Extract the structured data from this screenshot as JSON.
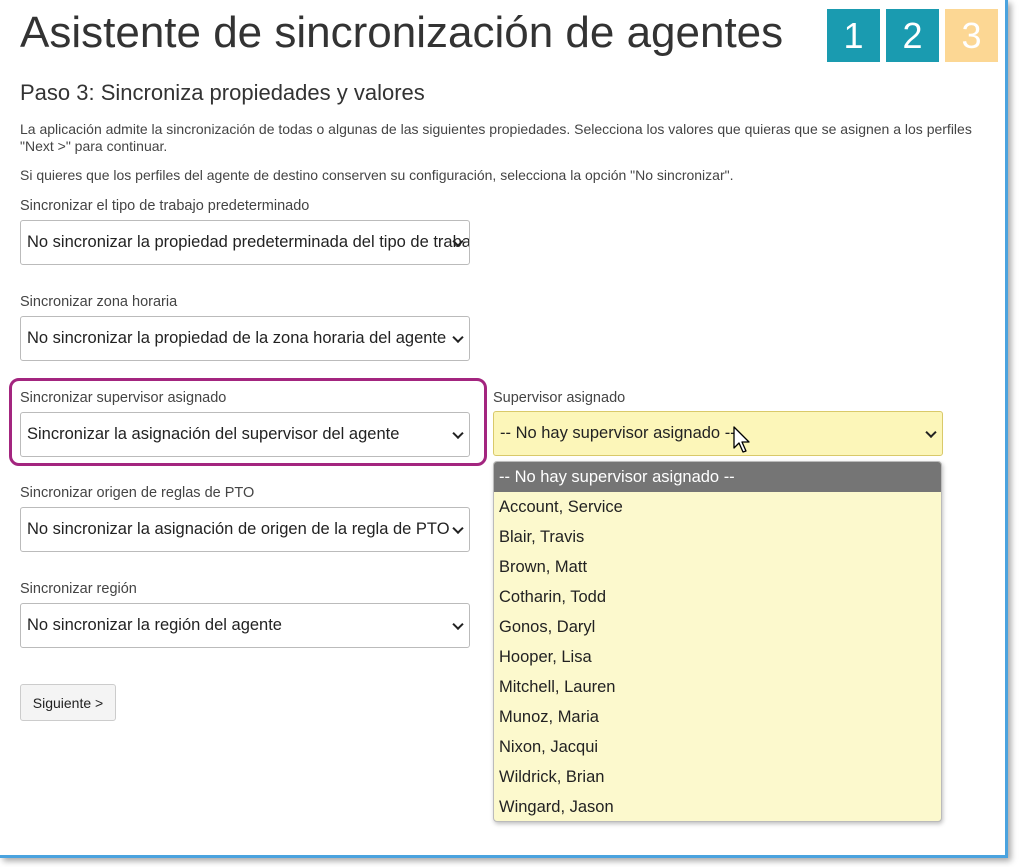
{
  "page": {
    "title": "Asistente de sincronización de agentes",
    "steps": [
      "1",
      "2",
      "3"
    ],
    "subtitle": "Paso 3: Sincroniza propiedades y valores",
    "description_line1": "La aplicación admite la sincronización de todas o algunas de las siguientes propiedades. Selecciona los valores que quieras que se asignen a los perfiles",
    "description_line2": "\"Next >\" para continuar.",
    "description_line3": "Si quieres que los perfiles del agente de destino conserven su configuración, selecciona la opción \"No sincronizar\"."
  },
  "fields": {
    "work_type": {
      "label": "Sincronizar el tipo de trabajo predeterminado",
      "value": "No sincronizar la propiedad predeterminada del tipo de trabajo"
    },
    "time_zone": {
      "label": "Sincronizar zona horaria",
      "value": "No sincronizar la propiedad de la zona horaria del agente"
    },
    "supervisor_sync": {
      "label": "Sincronizar supervisor asignado",
      "value": "Sincronizar la asignación del supervisor del agente"
    },
    "pto": {
      "label": "Sincronizar origen de reglas de PTO",
      "value": "No sincronizar la asignación de origen de la regla de PTO"
    },
    "region": {
      "label": "Sincronizar región",
      "value": "No sincronizar la región del agente"
    },
    "supervisor": {
      "label": "Supervisor asignado",
      "value": "-- No hay supervisor asignado --",
      "options": [
        "-- No hay supervisor asignado --",
        "Account, Service",
        "Blair, Travis",
        "Brown, Matt",
        "Cotharin, Todd",
        "Gonos, Daryl",
        "Hooper, Lisa",
        "Mitchell, Lauren",
        "Munoz, Maria",
        "Nixon, Jacqui",
        "Wildrick, Brian",
        "Wingard, Jason"
      ],
      "selected_index": 0
    }
  },
  "next_button": "Siguiente >",
  "colors": {
    "step_done": "#1a9bb0",
    "step_active": "#fcd794",
    "highlight": "#a3257f",
    "dropdown_bg": "#fcf9cd",
    "option_selected": "#757575"
  }
}
